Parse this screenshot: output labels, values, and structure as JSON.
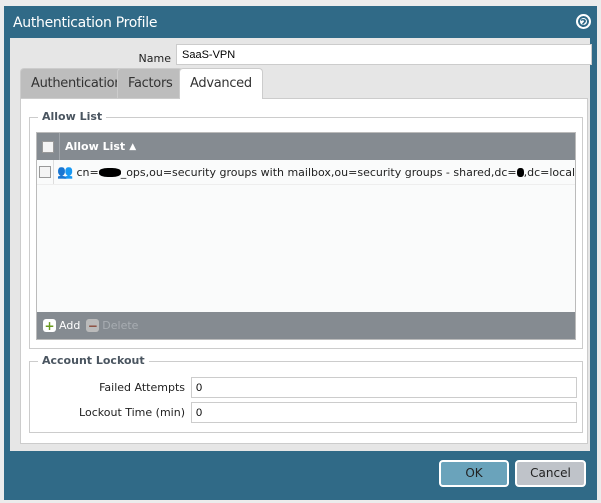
{
  "dialog": {
    "title": "Authentication Profile",
    "help_icon": "?"
  },
  "name": {
    "label": "Name",
    "value": "SaaS-VPN"
  },
  "tabs": [
    {
      "label": "Authentication"
    },
    {
      "label": "Factors"
    },
    {
      "label": "Advanced",
      "active": true
    }
  ],
  "allow_list": {
    "legend": "Allow List",
    "column_header": "Allow List",
    "sort": "ascending",
    "rows": [
      {
        "prefix": "cn=",
        "middle": "_ops,ou=security groups with mailbox,ou=security groups - shared,dc=",
        "suffix": ",dc=local"
      }
    ],
    "add_label": "Add",
    "delete_label": "Delete"
  },
  "account_lockout": {
    "legend": "Account Lockout",
    "failed_attempts": {
      "label": "Failed Attempts",
      "value": "0"
    },
    "lockout_time": {
      "label": "Lockout Time (min)",
      "value": "0"
    }
  },
  "buttons": {
    "ok": "OK",
    "cancel": "Cancel"
  },
  "colors": {
    "header": "#306a87",
    "ok": "#6aa3bb",
    "cancel": "#bfc3c9"
  }
}
